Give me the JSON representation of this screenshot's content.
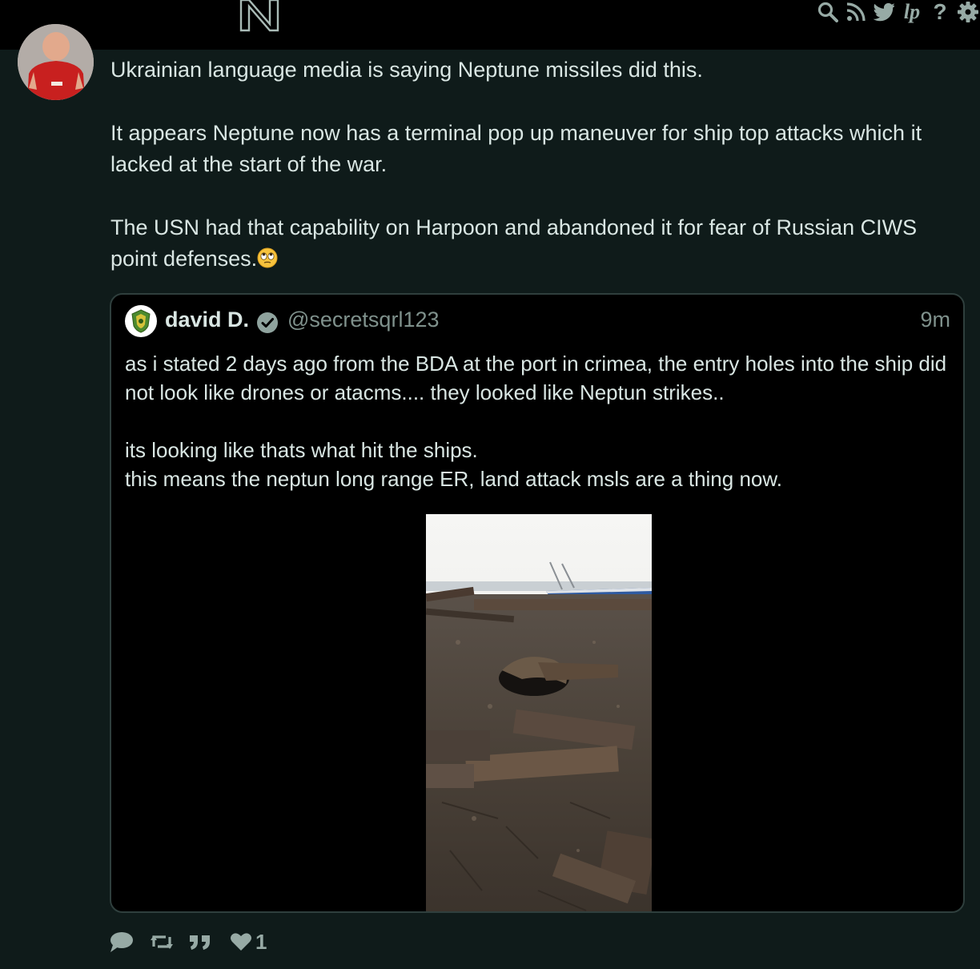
{
  "header": {
    "logo_letter": "N",
    "icons": [
      "search-icon",
      "rss-icon",
      "twitter-icon",
      "liberapay-icon",
      "help-icon",
      "gear-icon"
    ],
    "lp_label": "lp",
    "help_label": "?"
  },
  "post": {
    "avatar": "user-avatar",
    "paragraphs": [
      "Ukrainian language media is saying Neptune missiles did this.",
      "It appears Neptune now has a terminal pop up maneuver for ship top attacks which it lacked at the start of the war.",
      "The USN had that capability on Harpoon and abandoned it for fear of Russian CIWS point defenses."
    ],
    "emoji": "eye-roll-emoji"
  },
  "quote": {
    "name": "david D.",
    "handle": "@secretsqrl123",
    "time": "9m",
    "verified": true,
    "paragraph1": "as i stated 2 days ago from the BDA at the port in crimea, the entry holes into the ship did not look like drones or atacms.... they looked like Neptun strikes..",
    "line2": "its looking like thats what hit the ships.",
    "line3": "this means the neptun long range ER, land attack msls are a thing now.",
    "image": "damaged-deck-photo"
  },
  "actions": {
    "icons": [
      "reply-icon",
      "boost-icon",
      "quote-icon",
      "heart-icon"
    ],
    "like_count": "1"
  },
  "colors": {
    "background": "#0f1b1a",
    "topbar": "#000000",
    "text": "#d9e6e3",
    "muted": "#7f918c",
    "icons": "#97aaa5",
    "quote_border": "#2f3f3d"
  }
}
